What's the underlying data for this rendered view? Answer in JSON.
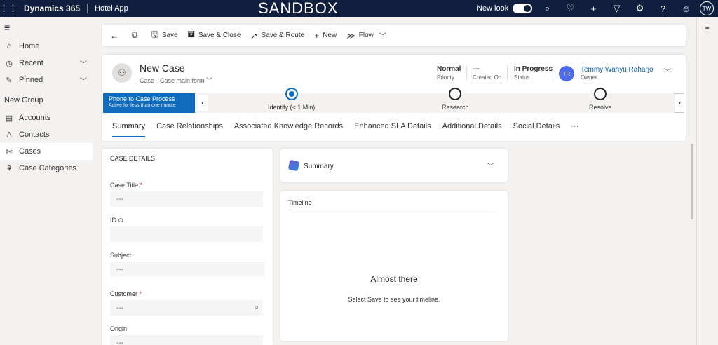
{
  "topbar": {
    "product": "Dynamics 365",
    "app": "Hotel App",
    "environment": "SANDBOX",
    "new_look": "New look",
    "user_initials": "TW"
  },
  "sidebar": {
    "items": [
      {
        "label": "Home",
        "icon": "home-icon"
      },
      {
        "label": "Recent",
        "icon": "clock-icon"
      },
      {
        "label": "Pinned",
        "icon": "pin-icon"
      }
    ],
    "group": "New Group",
    "entities": [
      {
        "label": "Accounts",
        "icon": "building-icon"
      },
      {
        "label": "Contacts",
        "icon": "person-icon"
      },
      {
        "label": "Cases",
        "icon": "wrench-icon"
      },
      {
        "label": "Case Categories",
        "icon": "puzzle-icon"
      }
    ]
  },
  "commands": {
    "save": "Save",
    "save_close": "Save & Close",
    "save_route": "Save & Route",
    "new": "New",
    "flow": "Flow"
  },
  "record": {
    "title": "New Case",
    "entity": "Case",
    "form": "Case main form",
    "priority": {
      "value": "Normal",
      "label": "Priority"
    },
    "created_on": {
      "value": "---",
      "label": "Created On"
    },
    "status": {
      "value": "In Progress",
      "label": "Status"
    },
    "owner": {
      "name": "Temmy Wahyu Raharjo",
      "initials": "TR",
      "label": "Owner"
    }
  },
  "bpf": {
    "name": "Phone to Case Process",
    "duration": "Active for less than one minute",
    "stages": [
      {
        "label": "Identify  (< 1 Min)"
      },
      {
        "label": "Research"
      },
      {
        "label": "Resolve"
      }
    ]
  },
  "tabs": [
    "Summary",
    "Case Relationships",
    "Associated Knowledge Records",
    "Enhanced SLA Details",
    "Additional Details",
    "Social Details",
    "···"
  ],
  "case_details": {
    "title": "CASE DETAILS",
    "fields": [
      {
        "label": "Case Title",
        "value": "---"
      },
      {
        "label": "ID",
        "value": ""
      },
      {
        "label": "Subject",
        "value": "---"
      },
      {
        "label": "Customer",
        "value": "---"
      },
      {
        "label": "Origin",
        "value": "---"
      }
    ]
  },
  "summary_card": {
    "title": "Summary"
  },
  "timeline": {
    "title": "Timeline",
    "empty_title": "Almost there",
    "empty_text": "Select Save to see your timeline."
  }
}
